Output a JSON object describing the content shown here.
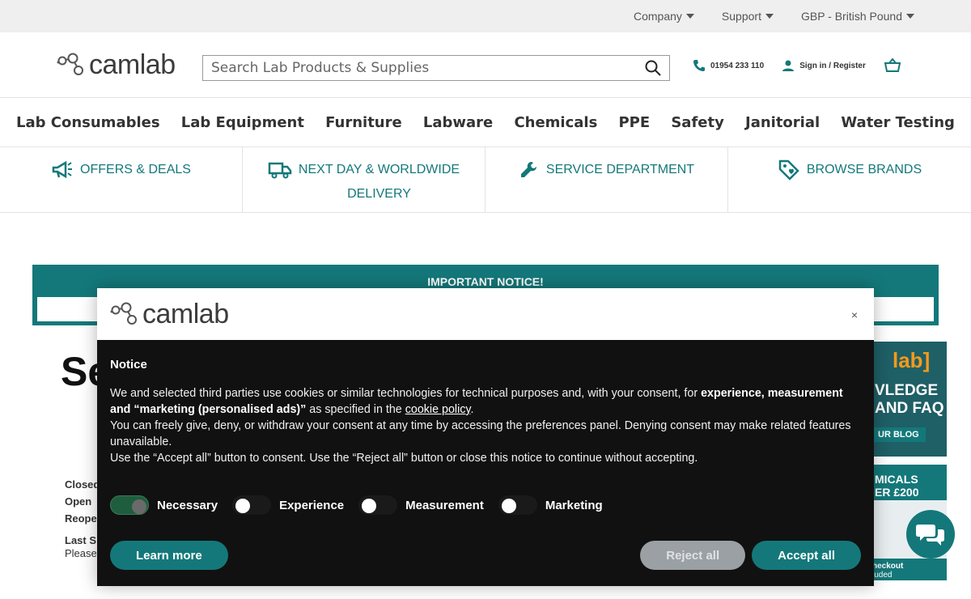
{
  "topbar": {
    "company": "Company",
    "support": "Support",
    "currency": "GBP - British Pound"
  },
  "header": {
    "logo_text": "camlab",
    "search_placeholder": "Search Lab Products & Supplies",
    "phone": "01954 233 110",
    "signin": "Sign in / Register"
  },
  "nav": {
    "items": [
      "Lab Consumables",
      "Lab Equipment",
      "Furniture",
      "Labware",
      "Chemicals",
      "PPE",
      "Safety",
      "Janitorial",
      "Water Testing"
    ]
  },
  "usp": {
    "offers": "OFFERS & DEALS",
    "delivery_1": "NEXT DAY & WORLDWIDE",
    "delivery_2": "DELIVERY",
    "service": "SERVICE DEPARTMENT",
    "brands": "BROWSE BRANDS"
  },
  "notice_banner": {
    "title": "IMPORTANT NOTICE!"
  },
  "background": {
    "left_heading": "Se",
    "left_lines": [
      "Closed",
      "Open",
      "Reope",
      "Last S",
      "Please"
    ],
    "blog_lines": [
      "lab]",
      "VLEDGE",
      "AND FAQ",
      "UR BLOG"
    ],
    "promo_lines": [
      "MICALS",
      "ER £200",
      "heckout",
      "luded"
    ]
  },
  "consent": {
    "logo_text": "camlab",
    "close": "×",
    "heading": "Notice",
    "p1_a": "We and selected third parties use cookies or similar technologies for technical purposes and, with your consent, for ",
    "p1_b": "experience, measurement and “marketing (personalised ads)”",
    "p1_c": " as specified in the ",
    "p1_link": "cookie policy",
    "p1_d": ".",
    "p2": "You can freely give, deny, or withdraw your consent at any time by accessing the preferences panel. Denying consent may make related features unavailable.",
    "p3": "Use the “Accept all” button to consent. Use the “Reject all” button or close this notice to continue without accepting.",
    "toggles": [
      {
        "label": "Necessary",
        "on": true
      },
      {
        "label": "Experience",
        "on": false
      },
      {
        "label": "Measurement",
        "on": false
      },
      {
        "label": "Marketing",
        "on": false
      }
    ],
    "learn_more": "Learn more",
    "reject_all": "Reject all",
    "accept_all": "Accept all"
  },
  "colors": {
    "teal": "#14787a",
    "topbar_bg": "#efefef",
    "modal_bg": "#111111"
  }
}
